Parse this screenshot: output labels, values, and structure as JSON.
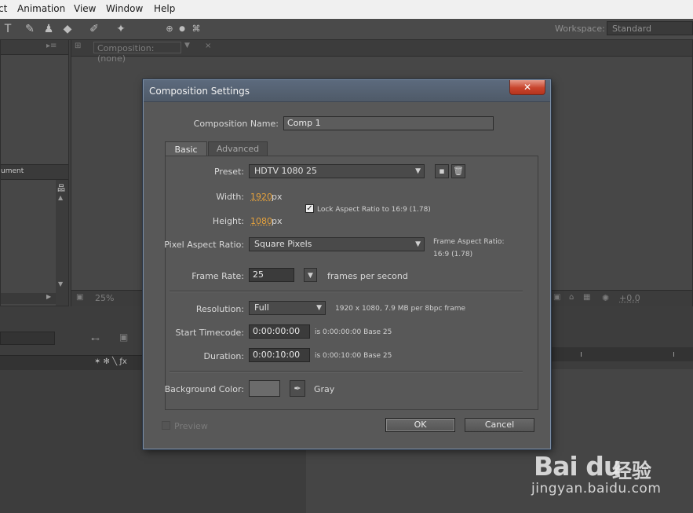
{
  "menubar": {
    "items": [
      "ct",
      "Animation",
      "View",
      "Window",
      "Help"
    ]
  },
  "toolbar": {
    "workspace_label": "Workspace:",
    "workspace_value": "Standard"
  },
  "background": {
    "comp_tab": "Composition: (none)",
    "project_col": "ument",
    "zoom": "25%",
    "exposure": "+0.0"
  },
  "dialog": {
    "title": "Composition Settings",
    "close_glyph": "✕",
    "comp_name_label": "Composition Name:",
    "comp_name_value": "Comp 1",
    "tabs": [
      "Basic",
      "Advanced"
    ],
    "preset_label": "Preset:",
    "preset_value": "HDTV 1080 25",
    "width_label": "Width:",
    "width_value": "1920",
    "height_label": "Height:",
    "height_value": "1080",
    "px_unit": "px",
    "lock_aspect_label": "Lock Aspect Ratio to 16:9 (1.78)",
    "lock_aspect_checked": true,
    "par_label": "Pixel Aspect Ratio:",
    "par_value": "Square Pixels",
    "frame_aspect_label": "Frame Aspect Ratio:",
    "frame_aspect_value": "16:9 (1.78)",
    "frame_rate_label": "Frame Rate:",
    "frame_rate_value": "25",
    "fps_label": "frames per second",
    "resolution_label": "Resolution:",
    "resolution_value": "Full",
    "resolution_info": "1920 x 1080, 7.9 MB per 8bpc frame",
    "start_tc_label": "Start Timecode:",
    "start_tc_value": "0:00:00:00",
    "start_tc_info": "is 0:00:00:00  Base 25",
    "duration_label": "Duration:",
    "duration_value": "0:00:10:00",
    "duration_info": "is 0:00:10:00  Base 25",
    "bg_color_label": "Background Color:",
    "bg_color_value": "#6b6b6b",
    "bg_color_name": "Gray",
    "preview_label": "Preview",
    "ok_label": "OK",
    "cancel_label": "Cancel"
  },
  "watermark": {
    "logo": "Bai du",
    "cn": "经验",
    "url": "jingyan.baidu.com"
  }
}
